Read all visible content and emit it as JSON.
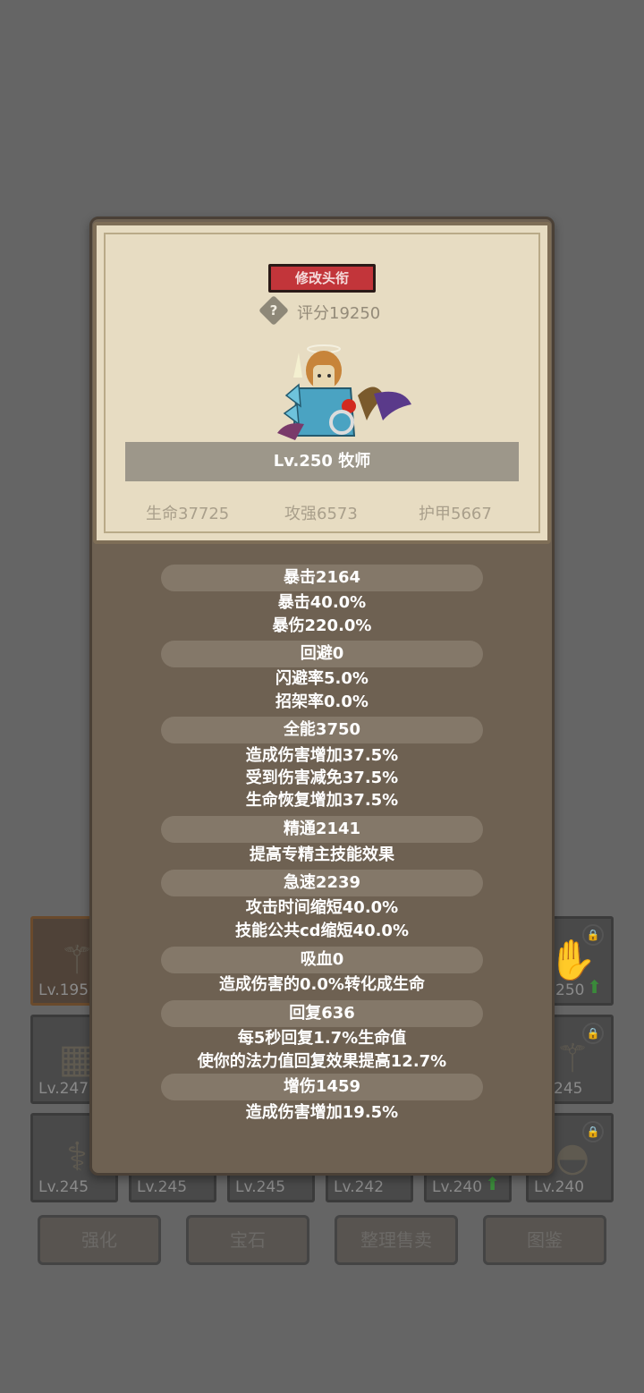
{
  "inventory": {
    "slots": [
      {
        "level": "Lv.195"
      },
      {
        "level": "250"
      },
      {
        "level": "Lv.247"
      },
      {
        "level": "245"
      },
      {
        "level": "Lv.245"
      },
      {
        "level": "Lv.245"
      },
      {
        "level": "Lv.245"
      },
      {
        "level": "Lv.242"
      },
      {
        "level": "Lv.240"
      },
      {
        "level": "Lv.240"
      }
    ],
    "buttons": {
      "enhance": "强化",
      "gem": "宝石",
      "sort_sell": "整理售卖",
      "codex": "图鉴"
    }
  },
  "header": {
    "rename_label": "修改头衔",
    "help_label": "?",
    "score_text": "评分19250",
    "name_text": "Lv.250 牧师",
    "hp_text": "生命37725",
    "attack_text": "攻强6573",
    "armor_text": "护甲5667"
  },
  "stats": [
    {
      "title": "暴击2164",
      "lines": [
        "暴击40.0%",
        "暴伤220.0%"
      ]
    },
    {
      "title": "回避0",
      "lines": [
        "闪避率5.0%",
        "招架率0.0%"
      ]
    },
    {
      "title": "全能3750",
      "lines": [
        "造成伤害增加37.5%",
        "受到伤害减免37.5%",
        "生命恢复增加37.5%"
      ]
    },
    {
      "title": "精通2141",
      "lines": [
        "提高专精主技能效果"
      ]
    },
    {
      "title": "急速2239",
      "lines": [
        "攻击时间缩短40.0%",
        "技能公共cd缩短40.0%"
      ]
    },
    {
      "title": "吸血0",
      "lines": [
        "造成伤害的0.0%转化成生命"
      ]
    },
    {
      "title": "回复636",
      "lines": [
        "每5秒回复1.7%生命值",
        "使你的法力值回复效果提高12.7%"
      ]
    },
    {
      "title": "增伤1459",
      "lines": [
        "造成伤害增加19.5%"
      ]
    }
  ],
  "colors": {
    "background": "#656565",
    "panel": "#6e6152",
    "parchment": "#e7dcc2",
    "rename_button": "#c2353a",
    "upgrade_arrow": "#3a8a3a"
  }
}
